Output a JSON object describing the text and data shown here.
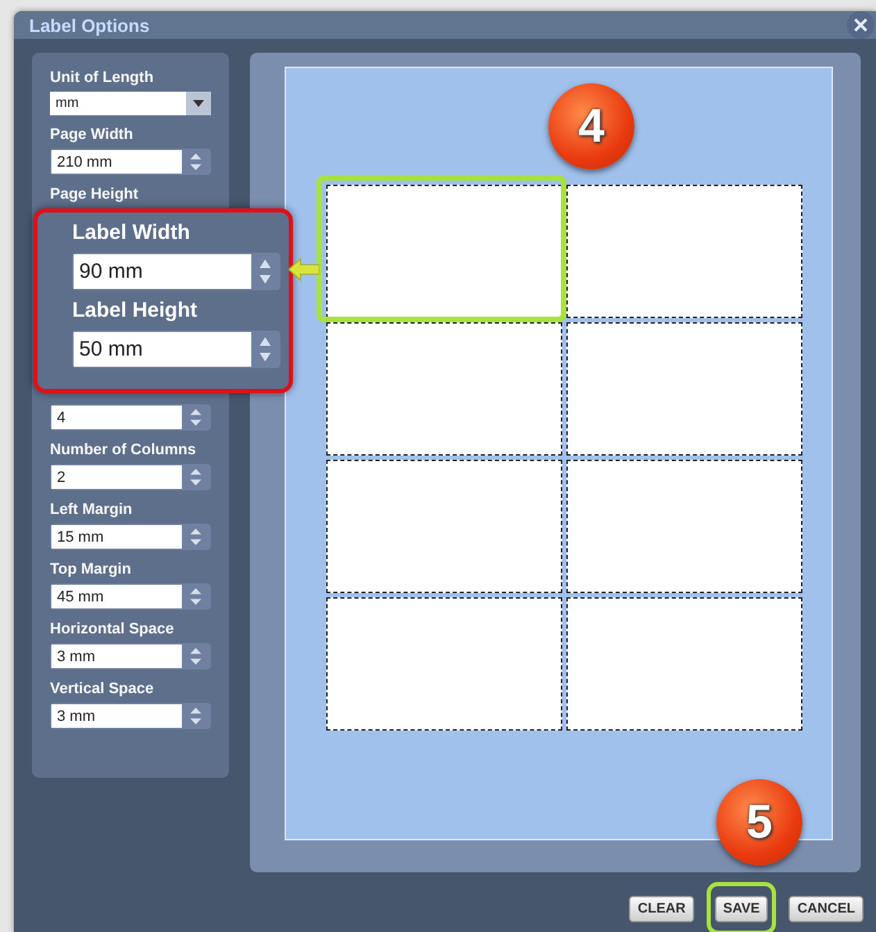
{
  "window": {
    "title": "Label Options"
  },
  "sidebar": {
    "fields": [
      {
        "kind": "select",
        "label": "Unit of Length",
        "value": "mm"
      },
      {
        "kind": "spin",
        "label": "Page Width",
        "value": "210 mm"
      },
      {
        "kind": "label",
        "label": "Page Height"
      },
      {
        "kind": "callout"
      },
      {
        "kind": "spin",
        "value": "4"
      },
      {
        "kind": "spin",
        "label": "Number of Columns",
        "value": "2"
      },
      {
        "kind": "spin",
        "label": "Left Margin",
        "value": "15 mm"
      },
      {
        "kind": "spin",
        "label": "Top Margin",
        "value": "45 mm"
      },
      {
        "kind": "spin",
        "label": "Horizontal Space",
        "value": "3 mm"
      },
      {
        "kind": "spin",
        "label": "Vertical Space",
        "value": "3 mm"
      }
    ]
  },
  "callout": {
    "fields": [
      {
        "label": "Label Width",
        "value": "90 mm"
      },
      {
        "label": "Label Height",
        "value": "50 mm"
      }
    ]
  },
  "preview": {
    "step_badge": "4",
    "labels": [
      {
        "highlighted": true
      },
      {
        "highlighted": false
      },
      {
        "highlighted": false
      },
      {
        "highlighted": false
      },
      {
        "highlighted": false
      },
      {
        "highlighted": false
      },
      {
        "highlighted": false
      },
      {
        "highlighted": false
      }
    ]
  },
  "footer": {
    "step_badge": "5",
    "buttons": [
      {
        "label": "CLEAR",
        "highlighted": false
      },
      {
        "label": "SAVE",
        "highlighted": true
      },
      {
        "label": "CANCEL",
        "highlighted": false
      }
    ]
  }
}
